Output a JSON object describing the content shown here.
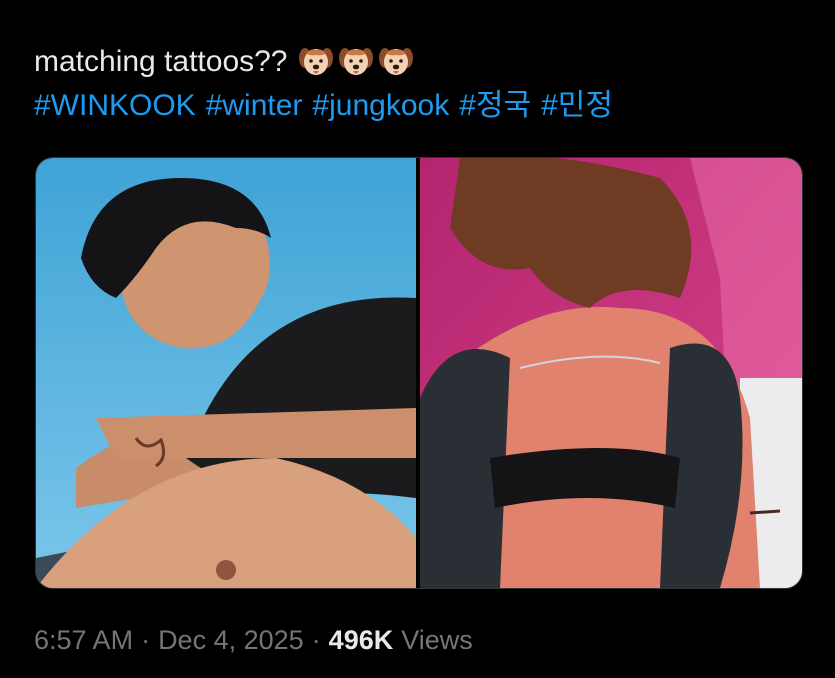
{
  "tweet": {
    "text": "matching tattoos??",
    "emojis": [
      "dog-face-emoji",
      "dog-face-emoji",
      "dog-face-emoji"
    ],
    "hashtags": [
      "#WINKOOK",
      "#winter",
      "#jungkook",
      "#정국",
      "#민정"
    ],
    "time": "6:57 AM",
    "separator": "·",
    "date": "Dec 4, 2025",
    "views_count": "496K",
    "views_label": "Views"
  },
  "media": {
    "left_photo": "photo-man-arm-tattoo",
    "right_photo": "photo-woman-arm-tattoo"
  },
  "colors": {
    "background": "#000000",
    "text": "#e7e9ea",
    "link": "#1d9bf0",
    "muted": "#71767b",
    "border": "#2f3336"
  }
}
